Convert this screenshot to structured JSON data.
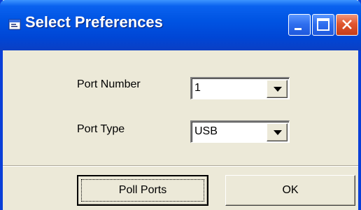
{
  "window": {
    "title": "Select Preferences"
  },
  "form": {
    "port_number": {
      "label": "Port Number",
      "value": "1"
    },
    "port_type": {
      "label": "Port Type",
      "value": "USB"
    }
  },
  "buttons": {
    "poll_ports": "Poll Ports",
    "ok": "OK"
  },
  "colors": {
    "titlebar": "#0054e3",
    "face": "#ece9d8",
    "close": "#e0562f"
  }
}
